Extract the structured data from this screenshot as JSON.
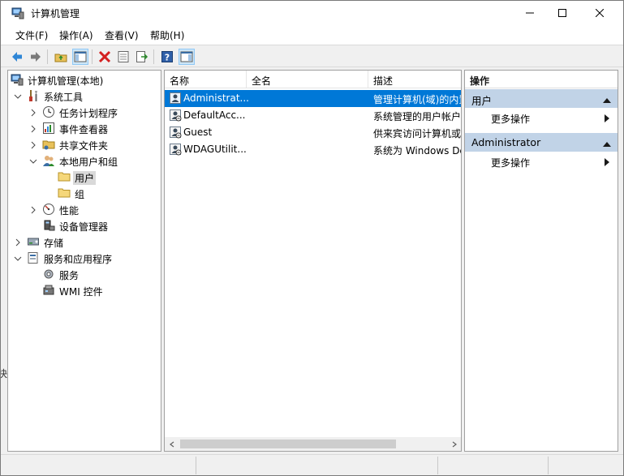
{
  "window": {
    "title": "计算机管理"
  },
  "menu": [
    "文件(F)",
    "操作(A)",
    "查看(V)",
    "帮助(H)"
  ],
  "toolbar": {
    "buttons": [
      "back-icon",
      "forward-icon",
      "up-folder-icon",
      "show-hide-tree-icon",
      "delete-icon",
      "properties-icon",
      "export-icon",
      "help-icon",
      "show-hide-action-pane-icon"
    ]
  },
  "tree": {
    "root": "计算机管理(本地)",
    "system_tools": "系统工具",
    "task_scheduler": "任务计划程序",
    "event_viewer": "事件查看器",
    "shared_folders": "共享文件夹",
    "local_users_groups": "本地用户和组",
    "users": "用户",
    "groups": "组",
    "performance": "性能",
    "device_manager": "设备管理器",
    "storage": "存储",
    "services_apps": "服务和应用程序",
    "services": "服务",
    "wmi": "WMI 控件"
  },
  "list": {
    "columns": [
      "名称",
      "全名",
      "描述"
    ],
    "rows": [
      {
        "name": "Administrat...",
        "full": "",
        "desc": "管理计算机(域)的内置"
      },
      {
        "name": "DefaultAcc...",
        "full": "",
        "desc": "系统管理的用户帐户"
      },
      {
        "name": "Guest",
        "full": "",
        "desc": "供来宾访问计算机或"
      },
      {
        "name": "WDAGUtilit...",
        "full": "",
        "desc": "系统为 Windows De"
      }
    ]
  },
  "actions": {
    "title": "操作",
    "group1": "用户",
    "group1_item": "更多操作",
    "group2": "Administrator",
    "group2_item": "更多操作"
  },
  "edge_text": "快",
  "colors": {
    "selection": "#0078d7",
    "action_group": "#c1d3e7"
  }
}
